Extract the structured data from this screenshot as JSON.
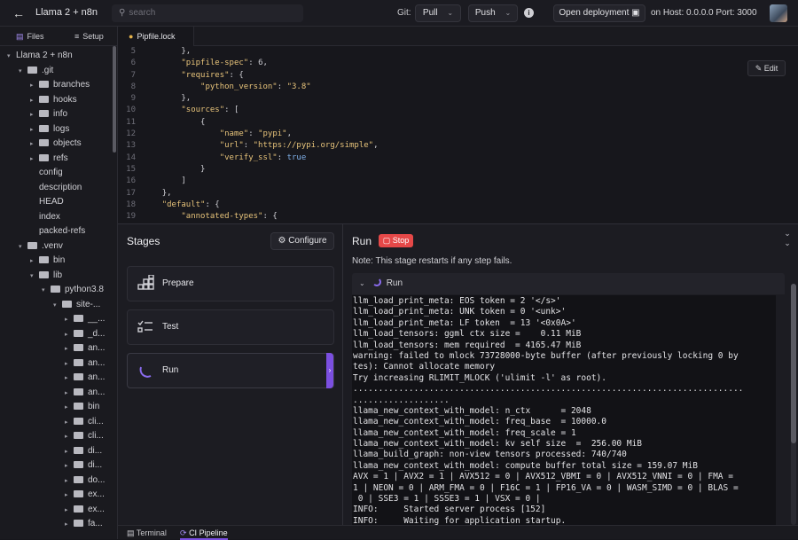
{
  "topbar": {
    "title": "Llama 2 + n8n",
    "search_placeholder": "search",
    "git_label": "Git:",
    "pull_label": "Pull",
    "push_label": "Push",
    "open_deployment_label": "Open deployment",
    "host_text": "on Host: 0.0.0.0 Port: 3000"
  },
  "sidebar": {
    "tabs": [
      "Files",
      "Setup"
    ],
    "tree": [
      {
        "label": "Llama 2 + n8n",
        "depth": 0,
        "type": "root",
        "open": true
      },
      {
        "label": ".git",
        "depth": 1,
        "type": "folder",
        "open": true
      },
      {
        "label": "branches",
        "depth": 2,
        "type": "folder"
      },
      {
        "label": "hooks",
        "depth": 2,
        "type": "folder"
      },
      {
        "label": "info",
        "depth": 2,
        "type": "folder"
      },
      {
        "label": "logs",
        "depth": 2,
        "type": "folder"
      },
      {
        "label": "objects",
        "depth": 2,
        "type": "folder"
      },
      {
        "label": "refs",
        "depth": 2,
        "type": "folder"
      },
      {
        "label": "config",
        "depth": 2,
        "type": "file"
      },
      {
        "label": "description",
        "depth": 2,
        "type": "file"
      },
      {
        "label": "HEAD",
        "depth": 2,
        "type": "file"
      },
      {
        "label": "index",
        "depth": 2,
        "type": "file"
      },
      {
        "label": "packed-refs",
        "depth": 2,
        "type": "file"
      },
      {
        "label": ".venv",
        "depth": 1,
        "type": "folder",
        "open": true
      },
      {
        "label": "bin",
        "depth": 2,
        "type": "folder"
      },
      {
        "label": "lib",
        "depth": 2,
        "type": "folder",
        "open": true
      },
      {
        "label": "python3.8",
        "depth": 3,
        "type": "folder",
        "open": true
      },
      {
        "label": "site-...",
        "depth": 4,
        "type": "folder",
        "open": true
      },
      {
        "label": "__...",
        "depth": 5,
        "type": "folder"
      },
      {
        "label": "_d...",
        "depth": 5,
        "type": "folder"
      },
      {
        "label": "an...",
        "depth": 5,
        "type": "folder"
      },
      {
        "label": "an...",
        "depth": 5,
        "type": "folder"
      },
      {
        "label": "an...",
        "depth": 5,
        "type": "folder"
      },
      {
        "label": "an...",
        "depth": 5,
        "type": "folder"
      },
      {
        "label": "bin",
        "depth": 5,
        "type": "folder"
      },
      {
        "label": "cli...",
        "depth": 5,
        "type": "folder"
      },
      {
        "label": "cli...",
        "depth": 5,
        "type": "folder"
      },
      {
        "label": "di...",
        "depth": 5,
        "type": "folder"
      },
      {
        "label": "di...",
        "depth": 5,
        "type": "folder"
      },
      {
        "label": "do...",
        "depth": 5,
        "type": "folder"
      },
      {
        "label": "ex...",
        "depth": 5,
        "type": "folder"
      },
      {
        "label": "ex...",
        "depth": 5,
        "type": "folder"
      },
      {
        "label": "fa...",
        "depth": 5,
        "type": "folder"
      }
    ]
  },
  "editor": {
    "tab_label": "Pipfile.lock",
    "edit_label": "Edit",
    "lines": [
      {
        "num": "5",
        "html": "        <span class='p'>},</span>"
      },
      {
        "num": "6",
        "html": "        <span class='k'>\"pipfile-spec\"</span><span class='p'>: </span><span class='n'>6</span><span class='p'>,</span>"
      },
      {
        "num": "7",
        "html": "        <span class='k'>\"requires\"</span><span class='p'>: {</span>"
      },
      {
        "num": "8",
        "html": "            <span class='k'>\"python_version\"</span><span class='p'>: </span><span class='s'>\"3.8\"</span>"
      },
      {
        "num": "9",
        "html": "        <span class='p'>},</span>"
      },
      {
        "num": "10",
        "html": "        <span class='k'>\"sources\"</span><span class='p'>: [</span>"
      },
      {
        "num": "11",
        "html": "            <span class='p'>{</span>"
      },
      {
        "num": "12",
        "html": "                <span class='k'>\"name\"</span><span class='p'>: </span><span class='s'>\"pypi\"</span><span class='p'>,</span>"
      },
      {
        "num": "13",
        "html": "                <span class='k'>\"url\"</span><span class='p'>: </span><span class='s'>\"https://pypi.org/simple\"</span><span class='p'>,</span>"
      },
      {
        "num": "14",
        "html": "                <span class='k'>\"verify_ssl\"</span><span class='p'>: </span><span class='b'>true</span>"
      },
      {
        "num": "15",
        "html": "            <span class='p'>}</span>"
      },
      {
        "num": "16",
        "html": "        <span class='p'>]</span>"
      },
      {
        "num": "17",
        "html": "    <span class='p'>},</span>"
      },
      {
        "num": "18",
        "html": "    <span class='k'>\"default\"</span><span class='p'>: {</span>"
      },
      {
        "num": "19",
        "html": "        <span class='k'>\"annotated-types\"</span><span class='p'>: {</span>"
      },
      {
        "num": "20",
        "html": "            <span class='k'>\"hashes\"</span><span class='p'>: [</span>"
      }
    ]
  },
  "stages": {
    "title": "Stages",
    "configure_label": "Configure",
    "items": [
      {
        "label": "Prepare",
        "icon": "grid-icon"
      },
      {
        "label": "Test",
        "icon": "checklist-icon"
      },
      {
        "label": "Run",
        "icon": "spinner-icon"
      }
    ]
  },
  "run": {
    "title": "Run",
    "stop_label": "Stop",
    "note": "Note: This stage restarts if any step fails.",
    "step_label": "Run",
    "log": [
      "llm_load_print_meta: EOS token = 2 '</s>'",
      "llm_load_print_meta: UNK token = 0 '<unk>'",
      "llm_load_print_meta: LF token  = 13 '<0x0A>'",
      "llm_load_tensors: ggml ctx size =    0.11 MiB",
      "llm_load_tensors: mem required  = 4165.47 MiB",
      "warning: failed to mlock 73728000-byte buffer (after previously locking 0 by",
      "tes): Cannot allocate memory",
      "Try increasing RLIMIT_MLOCK ('ulimit -l' as root).",
      ".............................................................................",
      "...................",
      "llama_new_context_with_model: n_ctx      = 2048",
      "llama_new_context_with_model: freq_base  = 10000.0",
      "llama_new_context_with_model: freq_scale = 1",
      "llama_new_context_with_model: kv self size  =  256.00 MiB",
      "llama_build_graph: non-view tensors processed: 740/740",
      "llama_new_context_with_model: compute buffer total size = 159.07 MiB",
      "AVX = 1 | AVX2 = 1 | AVX512 = 0 | AVX512_VBMI = 0 | AVX512_VNNI = 0 | FMA =",
      "1 | NEON = 0 | ARM_FMA = 0 | F16C = 1 | FP16_VA = 0 | WASM_SIMD = 0 | BLAS =",
      " 0 | SSE3 = 1 | SSSE3 = 1 | VSX = 0 |",
      "INFO:     Started server process [152]",
      "INFO:     Waiting for application startup."
    ]
  },
  "bottom": {
    "tabs": [
      "Terminal",
      "CI Pipeline"
    ],
    "active_tab": "CI Pipeline"
  }
}
